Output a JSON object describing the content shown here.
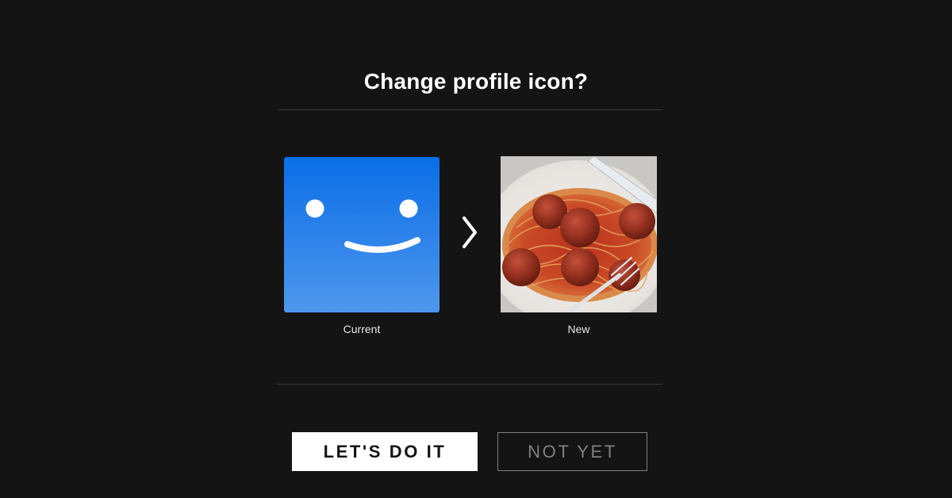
{
  "dialog": {
    "title": "Change profile icon?"
  },
  "avatars": {
    "current_label": "Current",
    "new_label": "New",
    "current_colors": {
      "top": "#0a6ee6",
      "bottom": "#4f97ec",
      "face": "#ffffff"
    },
    "new_image": "spaghetti-meatballs"
  },
  "actions": {
    "confirm_label": "LET'S DO IT",
    "cancel_label": "NOT YET"
  },
  "colors": {
    "background": "#141414",
    "text": "#ffffff",
    "muted": "#808080"
  }
}
